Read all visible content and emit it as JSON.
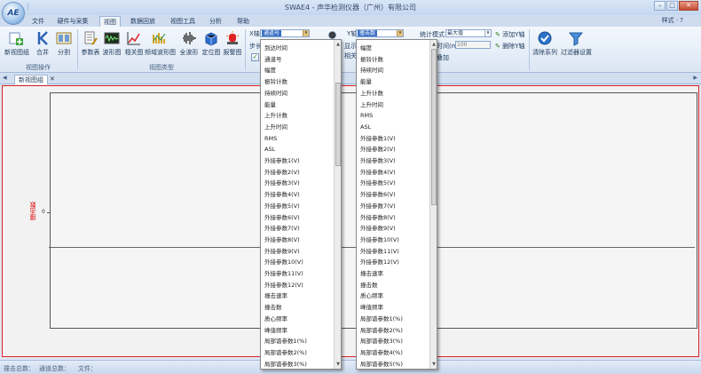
{
  "window": {
    "title": "SWAE4 - 声华检测仪器（广州）有限公司",
    "logo_text": "AE",
    "controls": {
      "minimize": "–",
      "maximize": "□",
      "close": "✕"
    }
  },
  "menu_tabs": [
    "文件",
    "硬件与采集",
    "视图",
    "数据回放",
    "视图工具",
    "分析",
    "帮助"
  ],
  "menu_active": "视图",
  "style_menu": "样式 · ?",
  "ribbon": {
    "groups": [
      {
        "label": "视图操作",
        "buttons": [
          "新视图组",
          "合并",
          "分割"
        ]
      },
      {
        "label": "视图类型",
        "buttons": [
          "参数表",
          "波形图",
          "相关图",
          "频域波形图",
          "全波形",
          "定位图",
          "报警图"
        ]
      },
      {
        "label": "视图叠加",
        "buttons": [
          "清除系列",
          "过滤器设置"
        ]
      }
    ],
    "x_axis_label": "X轴",
    "x_axis_value": "通道号",
    "y_axis_label": "Y轴",
    "y_axis_value": "撞击数",
    "step_label": "步长",
    "display_label": "显示",
    "relation_label": "相关",
    "stat_mode_label": "统计模式",
    "stat_mode_value": "最大值",
    "interval_label": "时间(ms)",
    "interval_value": "100",
    "add_y_axis": "添加Y轴",
    "remove_y_axis": "删除Y轴",
    "overlay_add": "叠加"
  },
  "doc_tabs": [
    "新视图组"
  ],
  "chart": {
    "y_label": "撞击数",
    "y_tick": "0"
  },
  "status": {
    "hits_total": "撞击总数：",
    "channel_total": "通道总数：",
    "file": "文件："
  },
  "x_dropdown_items": [
    "到达时间",
    "通道号",
    "幅度",
    "振铃计数",
    "持续时间",
    "能量",
    "上升计数",
    "上升时间",
    "RMS",
    "ASL",
    "外接参数1(V)",
    "外接参数2(V)",
    "外接参数3(V)",
    "外接参数4(V)",
    "外接参数5(V)",
    "外接参数6(V)",
    "外接参数7(V)",
    "外接参数8(V)",
    "外接参数9(V)",
    "外接参数10(V)",
    "外接参数11(V)",
    "外接参数12(V)",
    "撞击速率",
    "撞击数",
    "质心频率",
    "峰值频率",
    "局部谱参数1(%)",
    "局部谱参数2(%)",
    "局部谱参数3(%)"
  ],
  "y_dropdown_items": [
    "幅度",
    "振铃计数",
    "持续时间",
    "能量",
    "上升计数",
    "上升时间",
    "RMS",
    "ASL",
    "外接参数1(V)",
    "外接参数2(V)",
    "外接参数3(V)",
    "外接参数4(V)",
    "外接参数5(V)",
    "外接参数6(V)",
    "外接参数7(V)",
    "外接参数8(V)",
    "外接参数9(V)",
    "外接参数10(V)",
    "外接参数11(V)",
    "外接参数12(V)",
    "撞击速率",
    "撞击数",
    "质心频率",
    "峰值频率",
    "局部谱参数1(%)",
    "局部谱参数2(%)",
    "局部谱参数3(%)",
    "局部谱参数4(%)",
    "局部谱参数5(%)"
  ],
  "colors": {
    "accent": "#3a6fc4",
    "frame": "#dd2222"
  }
}
